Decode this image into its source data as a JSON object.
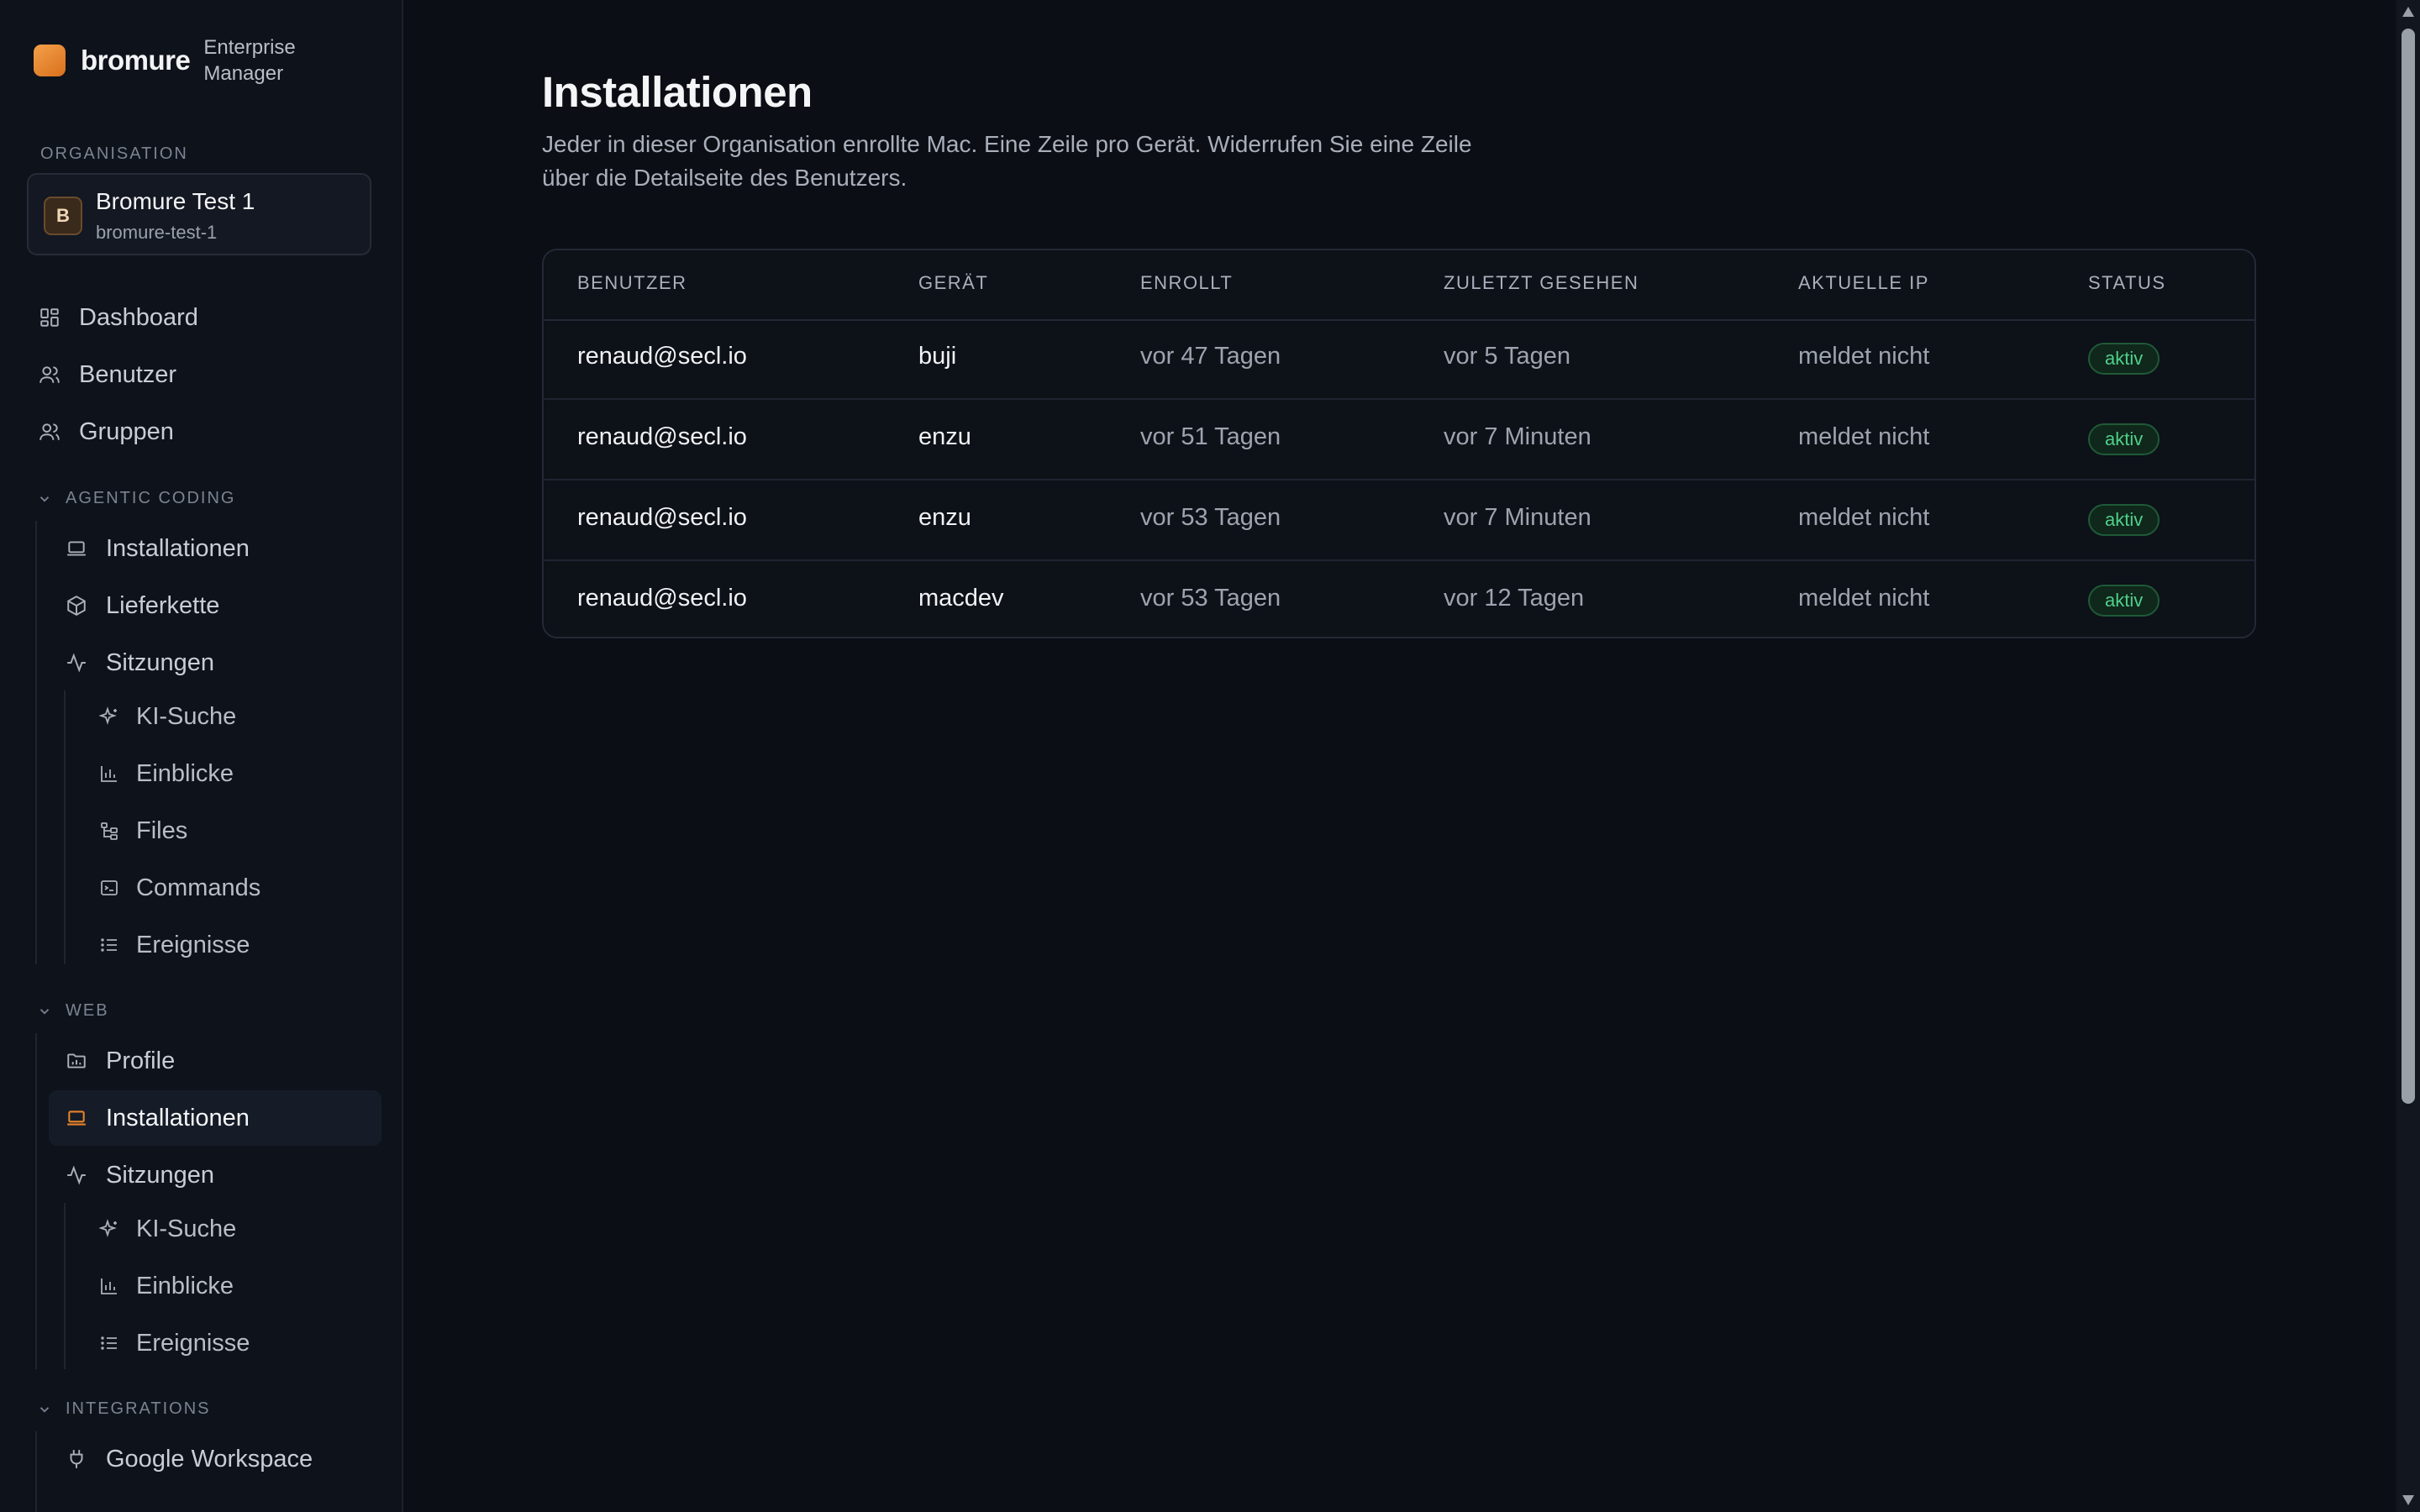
{
  "brand": {
    "name": "bromure",
    "subtitle_line1": "Enterprise",
    "subtitle_line2": "Manager"
  },
  "organisation": {
    "label": "ORGANISATION",
    "avatar_letter": "B",
    "name": "Bromure Test 1",
    "slug": "bromure-test-1"
  },
  "nav": {
    "top": [
      {
        "label": "Dashboard",
        "icon": "dashboard-icon"
      },
      {
        "label": "Benutzer",
        "icon": "users-icon"
      },
      {
        "label": "Gruppen",
        "icon": "groups-icon"
      }
    ],
    "agentic_coding": {
      "label": "AGENTIC CODING",
      "items": [
        {
          "label": "Installationen",
          "icon": "laptop-icon"
        },
        {
          "label": "Lieferkette",
          "icon": "package-icon"
        },
        {
          "label": "Sitzungen",
          "icon": "activity-icon"
        }
      ],
      "sub_items": [
        {
          "label": "KI-Suche",
          "icon": "sparkles-icon"
        },
        {
          "label": "Einblicke",
          "icon": "bar-chart-icon"
        },
        {
          "label": "Files",
          "icon": "file-tree-icon"
        },
        {
          "label": "Commands",
          "icon": "terminal-icon"
        },
        {
          "label": "Ereignisse",
          "icon": "list-icon"
        }
      ]
    },
    "web": {
      "label": "WEB",
      "items": [
        {
          "label": "Profile",
          "icon": "folder-icon"
        },
        {
          "label": "Installationen",
          "icon": "laptop-icon"
        },
        {
          "label": "Sitzungen",
          "icon": "activity-icon"
        }
      ],
      "sub_items": [
        {
          "label": "KI-Suche",
          "icon": "sparkles-icon"
        },
        {
          "label": "Einblicke",
          "icon": "bar-chart-icon"
        },
        {
          "label": "Ereignisse",
          "icon": "list-icon"
        }
      ]
    },
    "integrations": {
      "label": "INTEGRATIONS",
      "items": [
        {
          "label": "Google Workspace",
          "icon": "plug-icon"
        }
      ]
    },
    "active_item": "web.installationen"
  },
  "page": {
    "title": "Installationen",
    "description": "Jeder in dieser Organisation enrollte Mac. Eine Zeile pro Gerät. Widerrufen Sie eine Zeile über die Detailseite des Benutzers."
  },
  "table": {
    "columns": [
      "BENUTZER",
      "GERÄT",
      "ENROLLT",
      "ZULETZT GESEHEN",
      "AKTUELLE IP",
      "STATUS"
    ],
    "rows": [
      {
        "user": "renaud@secl.io",
        "device": "buji",
        "enrolled": "vor 47 Tagen",
        "last_seen": "vor 5 Tagen",
        "ip": "meldet nicht",
        "status": "aktiv"
      },
      {
        "user": "renaud@secl.io",
        "device": "enzu",
        "enrolled": "vor 51 Tagen",
        "last_seen": "vor 7 Minuten",
        "ip": "meldet nicht",
        "status": "aktiv"
      },
      {
        "user": "renaud@secl.io",
        "device": "enzu",
        "enrolled": "vor 53 Tagen",
        "last_seen": "vor 7 Minuten",
        "ip": "meldet nicht",
        "status": "aktiv"
      },
      {
        "user": "renaud@secl.io",
        "device": "macdev",
        "enrolled": "vor 53 Tagen",
        "last_seen": "vor 12 Tagen",
        "ip": "meldet nicht",
        "status": "aktiv"
      }
    ]
  },
  "colors": {
    "accent": "#e8832a",
    "status_active": "#4fd08a",
    "background": "#0b0e14",
    "sidebar": "#0e121a"
  }
}
